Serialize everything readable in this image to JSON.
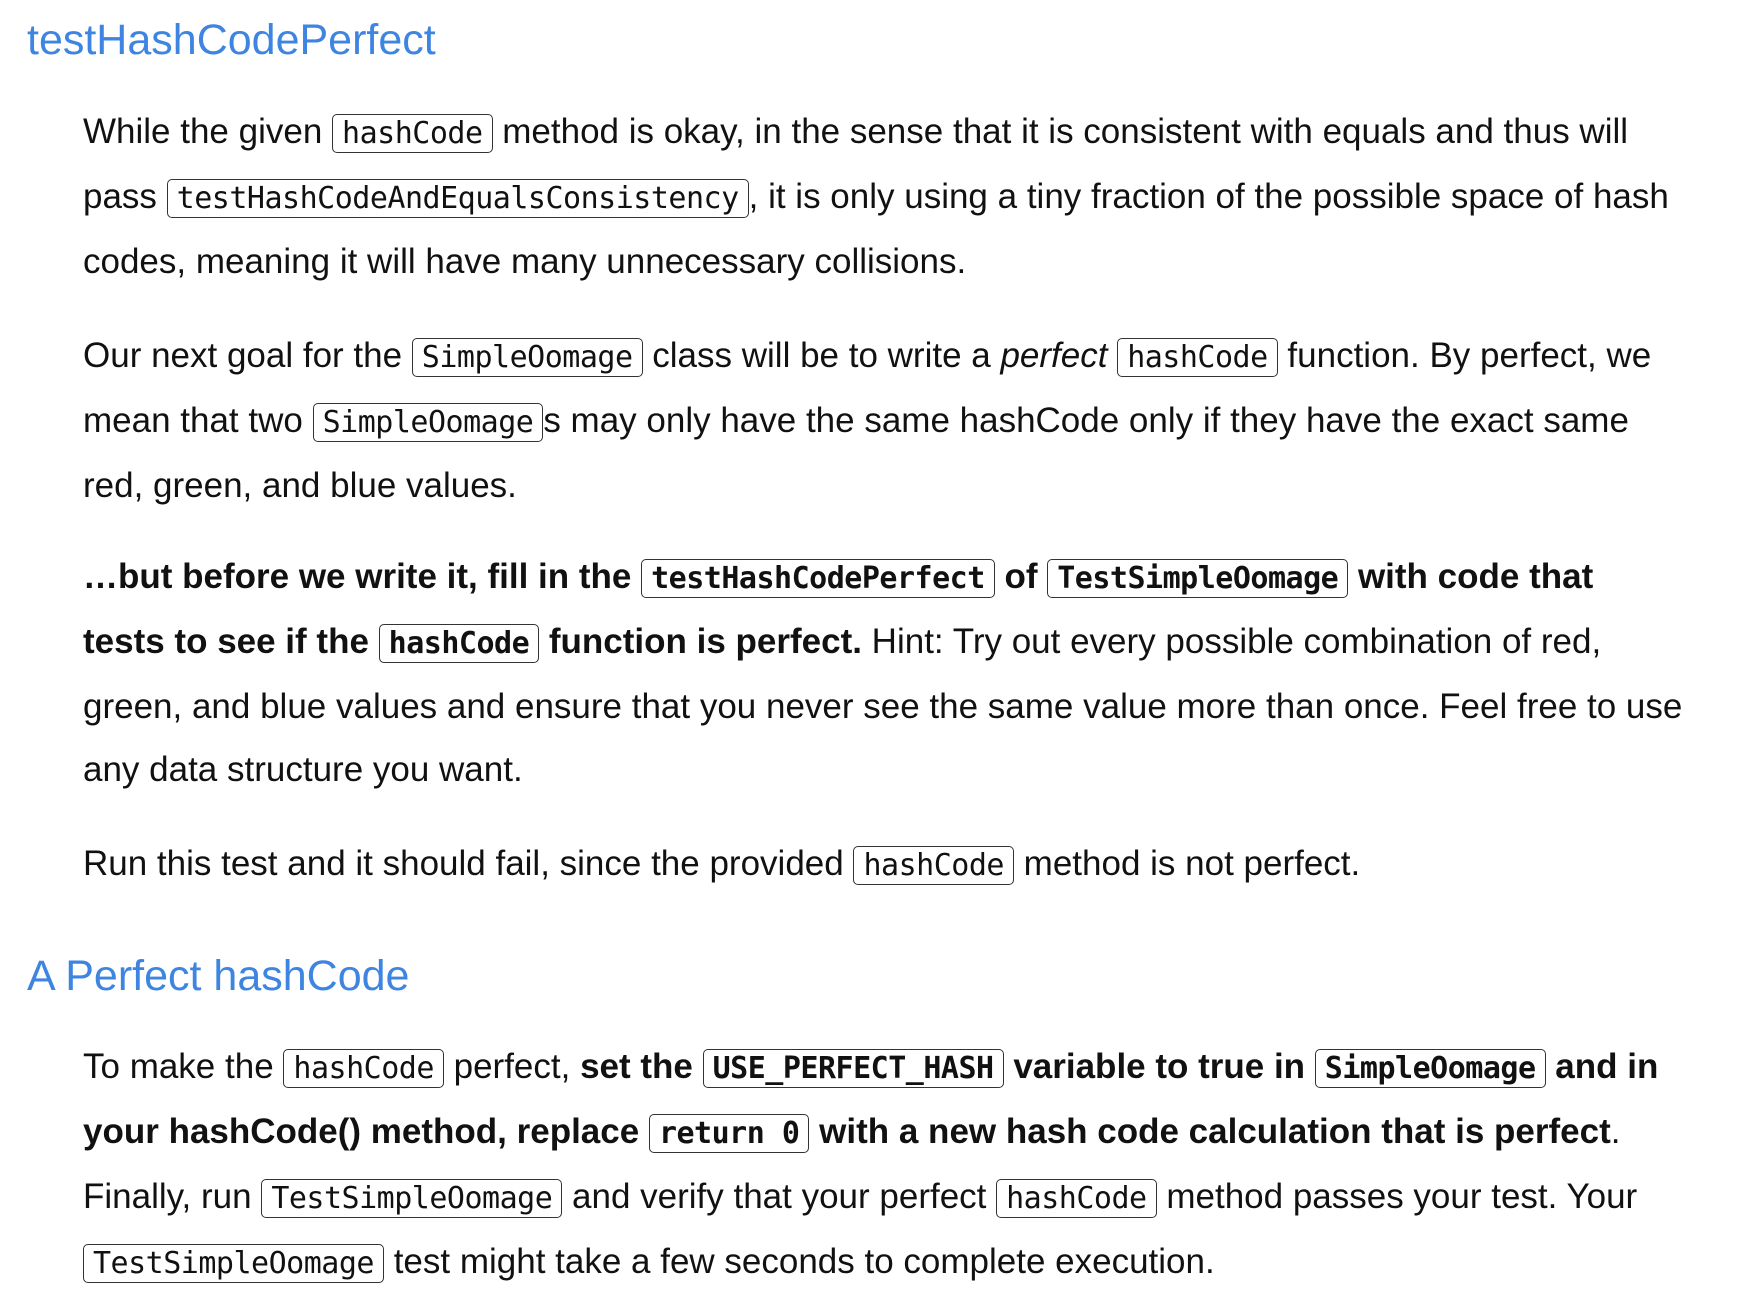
{
  "section1": {
    "title": "testHashCodePerfect",
    "p1": [
      "While the given ",
      "hashCode",
      " method is okay, in the sense that it is consistent with equals and thus will pass ",
      "testHashCodeAndEqualsConsistency",
      ", it is only using a tiny fraction of the possible space of hash codes, meaning it will have many unnecessary collisions."
    ],
    "p2": [
      "Our next goal for the ",
      "SimpleOomage",
      " class will be to write a ",
      "perfect",
      " ",
      "hashCode",
      " function. By perfect, we mean that two ",
      "SimpleOomage",
      "s may only have the same hashCode only if they have the exact same red, green, and blue values."
    ],
    "p3": [
      "…but before we write it, fill in the ",
      "testHashCodePerfect",
      " of ",
      "TestSimpleOomage",
      " with code that tests to see if the ",
      "hashCode",
      " function is perfect.",
      " Hint: Try out every possible combination of red, green, and blue values and ensure that you never see the same value more than once. Feel free to use any data structure you want."
    ],
    "p4": [
      "Run this test and it should fail, since the provided ",
      "hashCode",
      " method is not perfect."
    ]
  },
  "section2": {
    "title": "A Perfect hashCode",
    "p5": [
      "To make the ",
      "hashCode",
      " perfect, ",
      "set the ",
      "USE_PERFECT_HASH",
      " variable to true in ",
      "SimpleOomage",
      " and in your hashCode() method, replace ",
      "return 0",
      " with a new hash code calculation that is perfect",
      ". Finally, run ",
      "TestSimpleOomage",
      " and verify that your perfect ",
      "hashCode",
      " method passes your test. Your ",
      "TestSimpleOomage",
      " test might take a few seconds to complete execution."
    ]
  }
}
